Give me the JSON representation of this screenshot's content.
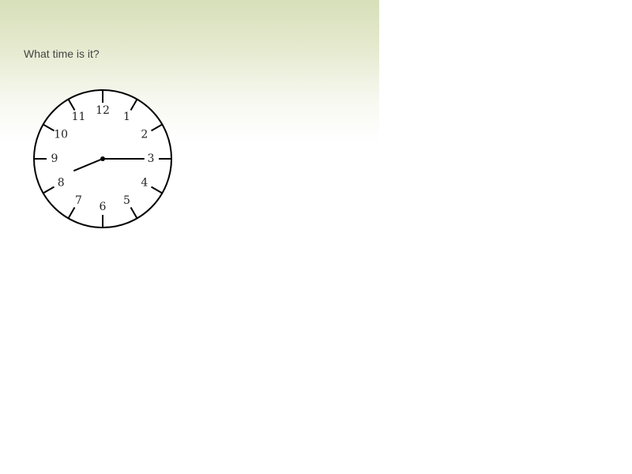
{
  "question": {
    "text": "What time is it?"
  },
  "clock": {
    "numerals": [
      "12",
      "1",
      "2",
      "3",
      "4",
      "5",
      "6",
      "7",
      "8",
      "9",
      "10",
      "11"
    ],
    "time": {
      "hour": 8,
      "minute": 15
    },
    "face_color": "#ffffff",
    "stroke_color": "#000000"
  }
}
